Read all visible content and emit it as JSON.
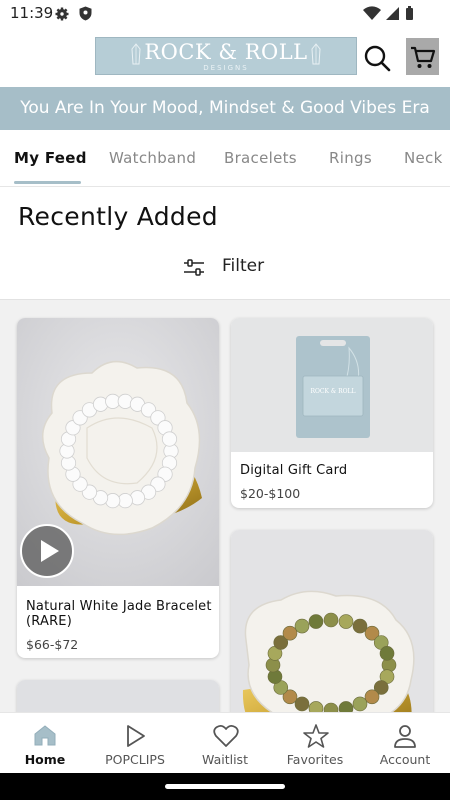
{
  "status_bar": {
    "time": "11:39"
  },
  "header": {
    "logo_text": "ROCK & ROLL",
    "logo_subtext": "DESIGNS",
    "search_icon": "search-icon",
    "cart_icon": "cart-icon"
  },
  "banner": {
    "text": "You Are In Your Mood, Mindset & Good Vibes Era"
  },
  "tabs": [
    {
      "label": "My Feed",
      "active": true
    },
    {
      "label": "Watchband"
    },
    {
      "label": "Bracelets"
    },
    {
      "label": "Rings"
    },
    {
      "label": "Neck"
    }
  ],
  "section": {
    "title": "Recently Added",
    "filter_label": "Filter",
    "filter_icon": "sliders-icon"
  },
  "products": [
    {
      "name": "Natural White Jade Bracelet (RARE)",
      "price": "$66-$72",
      "has_video": true
    },
    {
      "name": "Digital Gift Card",
      "price": "$20-$100",
      "card_text": "ROCK & ROLL"
    },
    {
      "name": "",
      "price": ""
    },
    {
      "name": "",
      "price": ""
    }
  ],
  "bottom_nav": [
    {
      "label": "Home",
      "icon": "home-icon",
      "active": true
    },
    {
      "label": "POPCLIPS",
      "icon": "play-icon"
    },
    {
      "label": "Waitlist",
      "icon": "heart-icon"
    },
    {
      "label": "Favorites",
      "icon": "star-icon"
    },
    {
      "label": "Account",
      "icon": "person-icon"
    }
  ],
  "colors": {
    "brand": "#a6bec8",
    "logo_bg": "#b6cdd6",
    "cart_bg": "#a9a9a9",
    "gold": "#c9a233"
  }
}
